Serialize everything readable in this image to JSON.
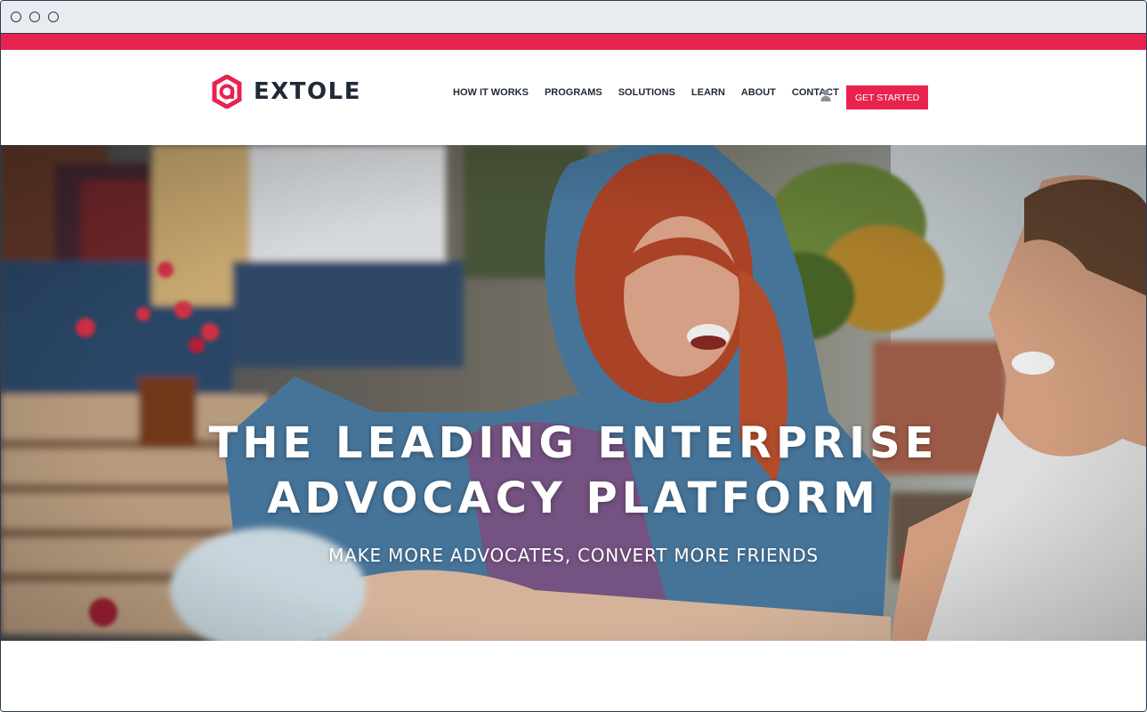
{
  "browser": {
    "controls": [
      "close",
      "minimize",
      "maximize"
    ]
  },
  "brand": {
    "name": "EXTOLE",
    "logo_icon": "extole-hexagon-icon",
    "accent_color": "#e8234f",
    "text_color": "#1f2a36"
  },
  "nav": {
    "items": [
      "HOW IT WORKS",
      "PROGRAMS",
      "SOLUTIONS",
      "LEARN",
      "ABOUT",
      "CONTACT"
    ],
    "account_icon": "user-icon",
    "cta_label": "GET STARTED"
  },
  "hero": {
    "title_line1": "THE LEADING ENTERPRISE",
    "title_line2": "ADVOCACY PLATFORM",
    "subtitle": "MAKE MORE ADVOCATES, CONVERT MORE FRIENDS",
    "image": "friends-laughing-photo"
  }
}
